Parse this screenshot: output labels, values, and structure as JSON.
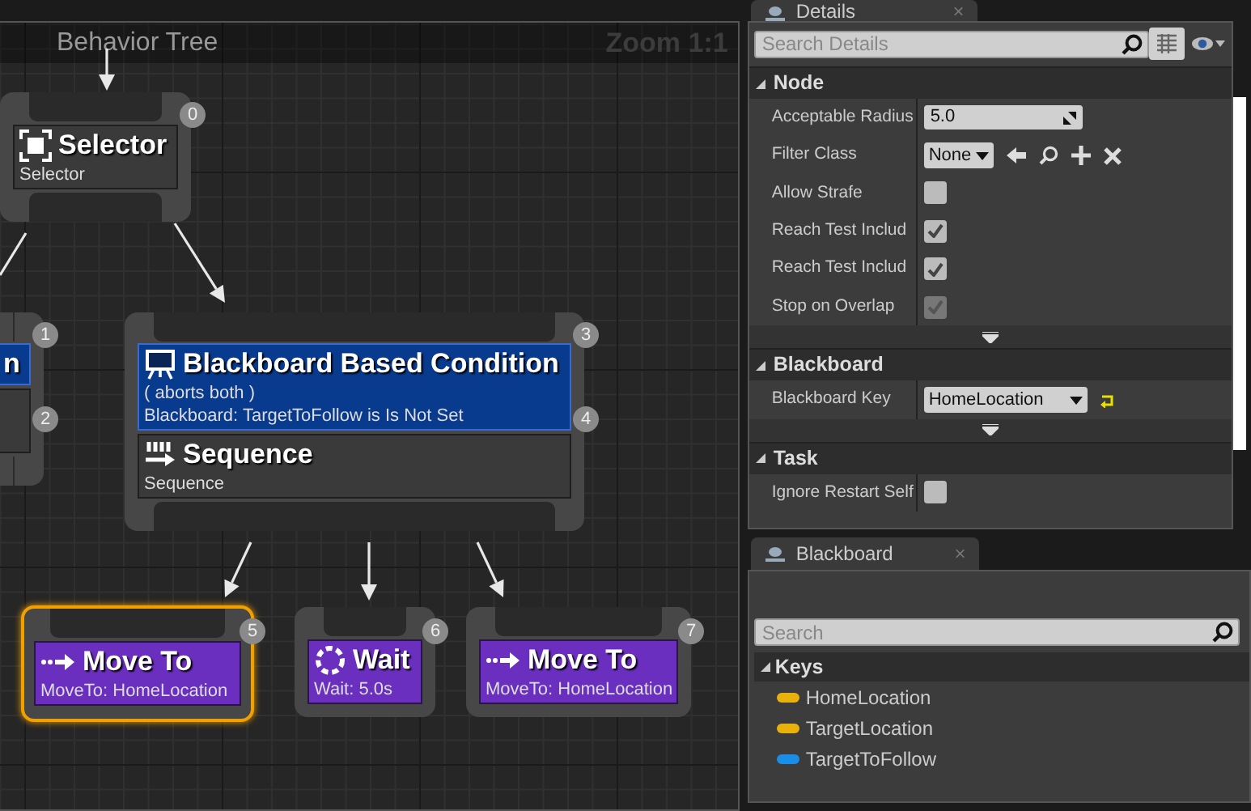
{
  "graph": {
    "title": "Behavior Tree",
    "zoom": "Zoom 1:1",
    "nodes": [
      {
        "kind": "selector",
        "title": "Selector",
        "subtitle": "Selector",
        "badges": [
          "0"
        ],
        "selected": false
      },
      {
        "kind": "blank",
        "badges": [
          "1",
          "2"
        ],
        "selected": false,
        "decorators": [
          {
            "title": "n"
          }
        ]
      },
      {
        "kind": "sequence",
        "title": "Sequence",
        "subtitle": "Sequence",
        "badges": [
          "3",
          "4"
        ],
        "selected": false,
        "decorators": [
          {
            "title": "Blackboard Based Condition",
            "lines": [
              "( aborts both )",
              "Blackboard: TargetToFollow is Is Not Set"
            ]
          }
        ]
      },
      {
        "kind": "move",
        "title": "Move To",
        "subtitle": "MoveTo: HomeLocation",
        "badges": [
          "5"
        ],
        "selected": true
      },
      {
        "kind": "wait",
        "title": "Wait",
        "subtitle": "Wait: 5.0s",
        "badges": [
          "6"
        ],
        "selected": false
      },
      {
        "kind": "move",
        "title": "Move To",
        "subtitle": "MoveTo: HomeLocation",
        "badges": [
          "7"
        ],
        "selected": false
      }
    ]
  },
  "details": {
    "tab": {
      "title": "Details",
      "close": "×"
    },
    "search": {
      "placeholder": "Search Details"
    },
    "sections": [
      {
        "title": "Node",
        "expanded": true,
        "has_more": true,
        "properties": [
          {
            "label": "Acceptable Radius",
            "kind": "number",
            "value": "5.0"
          },
          {
            "label": "Filter Class",
            "kind": "class",
            "value": "None"
          },
          {
            "label": "Allow Strafe",
            "kind": "checkbox",
            "checked": false,
            "disabled": false
          },
          {
            "label": "Reach Test Includ",
            "kind": "checkbox",
            "checked": true,
            "disabled": false
          },
          {
            "label": "Reach Test Includ",
            "kind": "checkbox",
            "checked": true,
            "disabled": false
          },
          {
            "label": "Stop on Overlap",
            "kind": "checkbox",
            "checked": true,
            "disabled": true
          }
        ]
      },
      {
        "title": "Blackboard",
        "expanded": true,
        "has_more": true,
        "properties": [
          {
            "label": "Blackboard Key",
            "kind": "key",
            "value": "HomeLocation"
          }
        ]
      },
      {
        "title": "Task",
        "expanded": true,
        "has_more": false,
        "properties": [
          {
            "label": "Ignore Restart Self",
            "kind": "checkbox",
            "checked": false,
            "disabled": false
          }
        ]
      }
    ]
  },
  "blackboard": {
    "tab": {
      "title": "Blackboard",
      "close": "×"
    },
    "search": {
      "placeholder": "Search"
    },
    "group": {
      "title": "Keys",
      "expanded": true,
      "keys": [
        {
          "name": "HomeLocation",
          "color": "#e8b10c"
        },
        {
          "name": "TargetLocation",
          "color": "#e8b10c"
        },
        {
          "name": "TargetToFollow",
          "color": "#1a8ee6"
        }
      ]
    }
  }
}
